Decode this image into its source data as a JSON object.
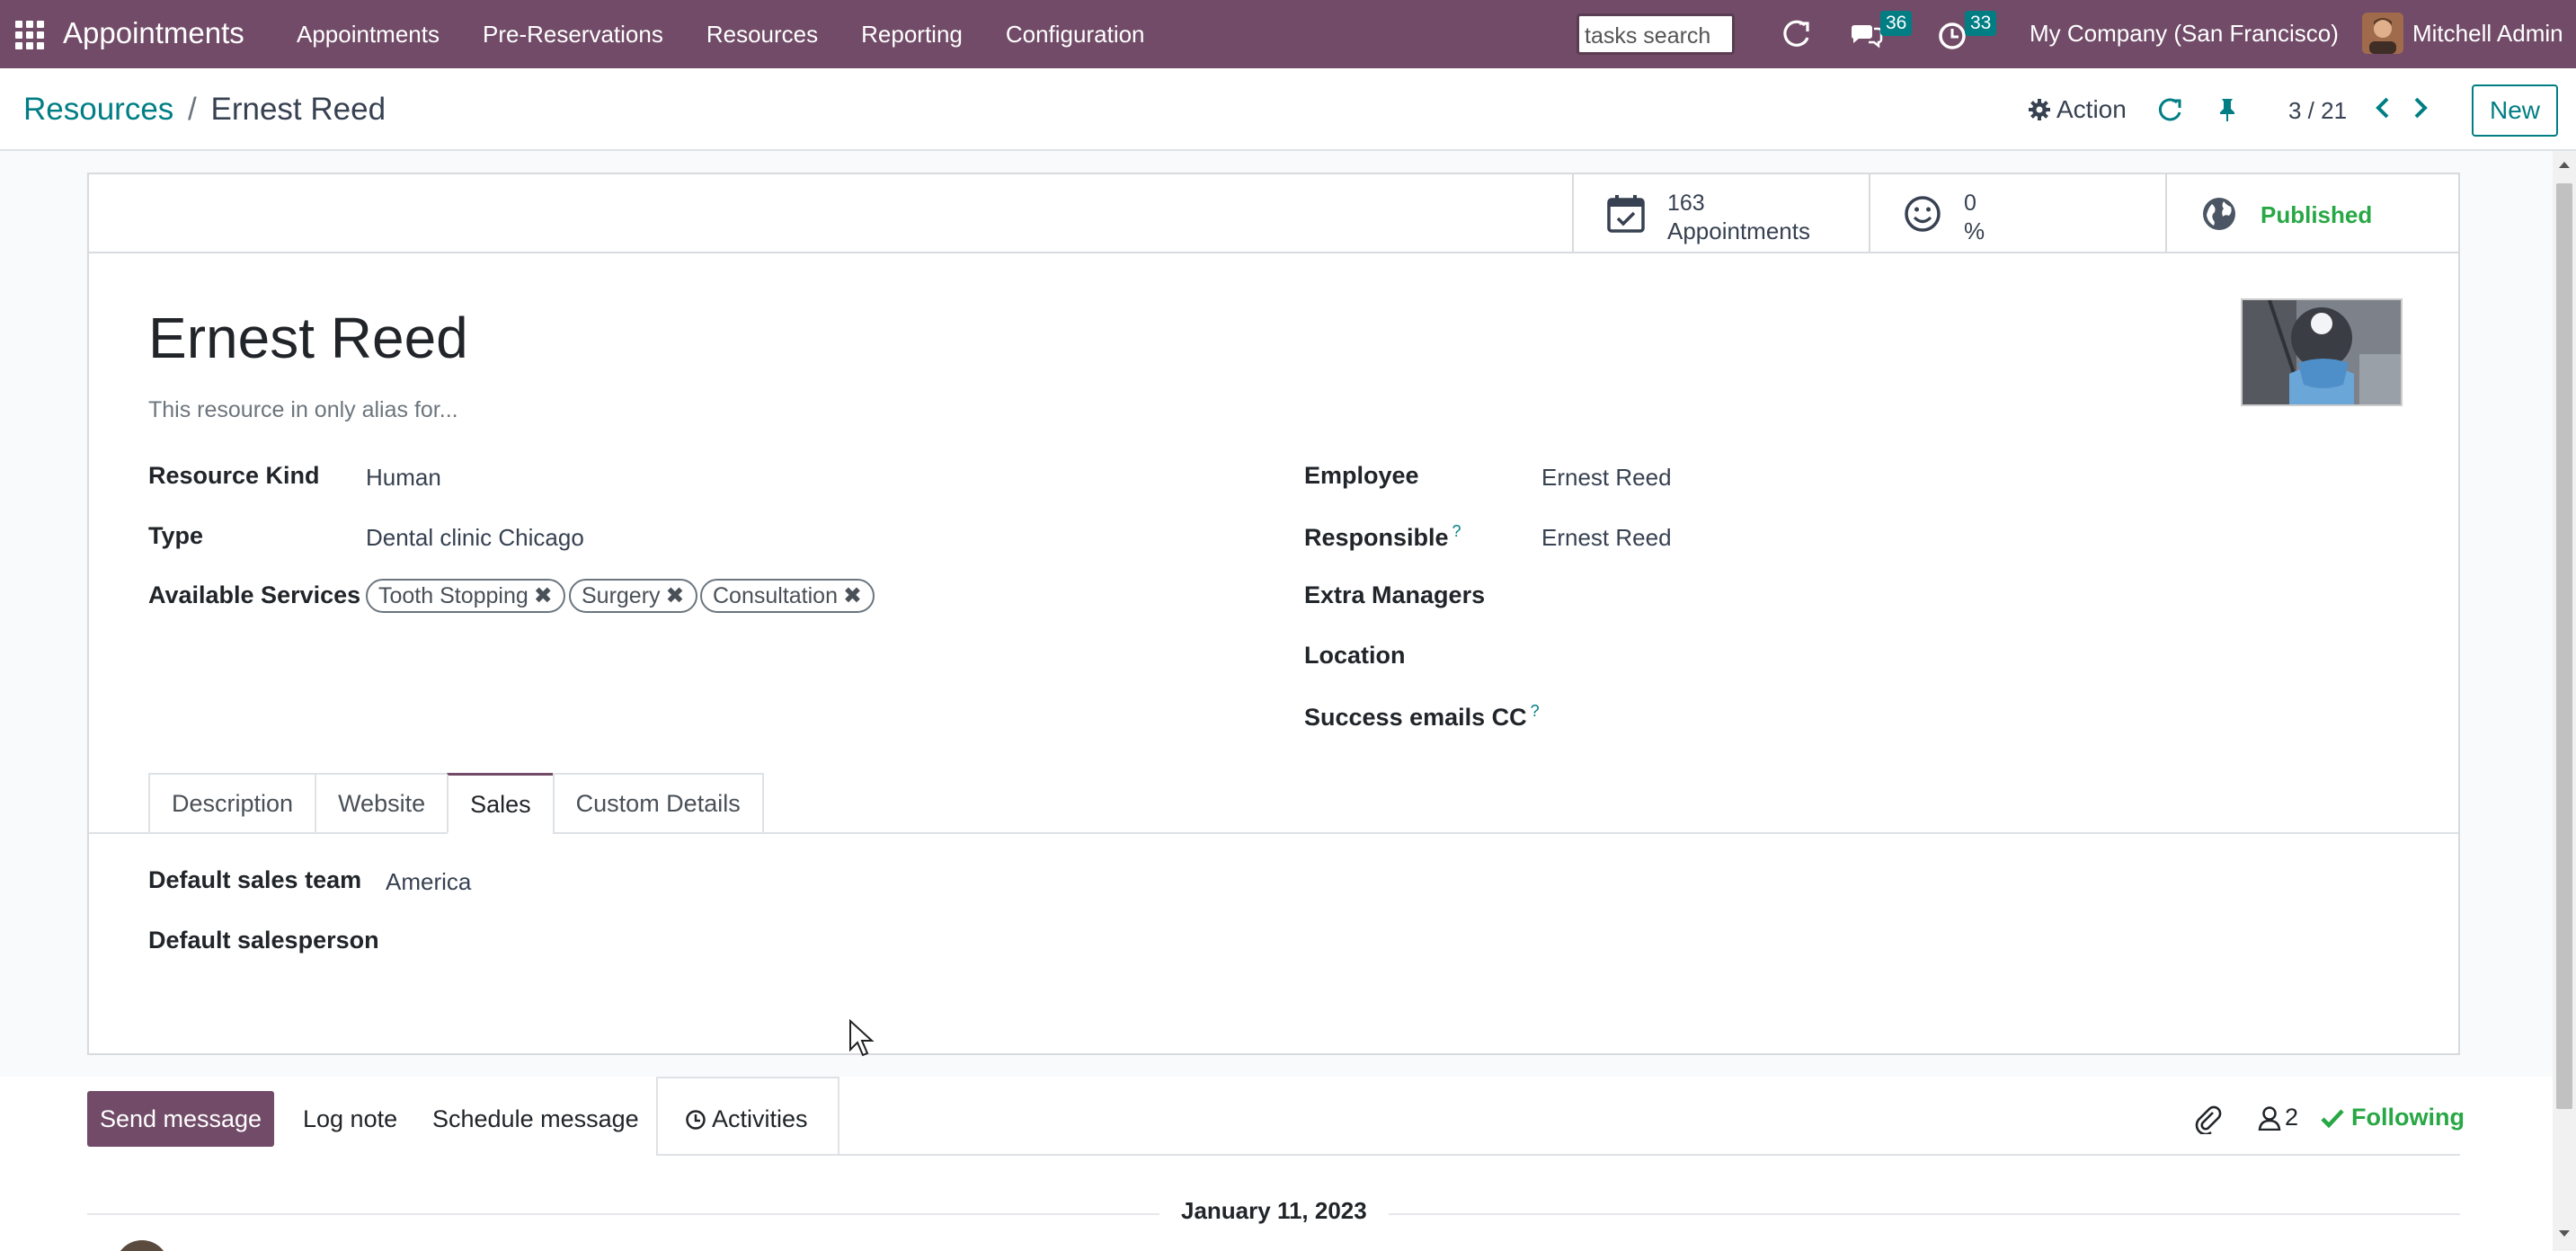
{
  "navbar": {
    "brand": "Appointments",
    "menu": [
      "Appointments",
      "Pre-Reservations",
      "Resources",
      "Reporting",
      "Configuration"
    ],
    "search_placeholder": "tasks search",
    "messages_count": "36",
    "activities_count": "33",
    "company": "My Company (San Francisco)",
    "user": "Mitchell Admin"
  },
  "control_panel": {
    "breadcrumb_parent": "Resources",
    "breadcrumb_separator": "/",
    "breadcrumb_current": "Ernest Reed",
    "action_label": "Action",
    "pager": "3 / 21",
    "new_label": "New"
  },
  "stat_buttons": {
    "appointments_value": "163",
    "appointments_label": "Appointments",
    "rating_value": "0",
    "rating_label": "%",
    "published_label": "Published"
  },
  "form": {
    "name": "Ernest Reed",
    "subtitle": "This resource in only alias for...",
    "left_fields": [
      {
        "label": "Resource Kind",
        "value": "Human"
      },
      {
        "label": "Type",
        "value": "Dental clinic Chicago"
      },
      {
        "label": "Available Services",
        "value": ""
      }
    ],
    "services": [
      "Tooth Stopping",
      "Surgery",
      "Consultation"
    ],
    "right_fields": [
      {
        "label": "Employee",
        "value": "Ernest Reed"
      },
      {
        "label": "Responsible",
        "value": "Ernest Reed",
        "help": "?"
      },
      {
        "label": "Extra Managers",
        "value": ""
      },
      {
        "label": "Location",
        "value": ""
      },
      {
        "label": "Success emails CC",
        "value": "",
        "help": "?"
      }
    ],
    "tabs": [
      "Description",
      "Website",
      "Sales",
      "Custom Details"
    ],
    "active_tab": "Sales",
    "sales_fields": [
      {
        "label": "Default sales team",
        "value": "America"
      },
      {
        "label": "Default salesperson",
        "value": ""
      }
    ]
  },
  "chatter": {
    "send_message": "Send message",
    "log_note": "Log note",
    "schedule_message": "Schedule message",
    "activities": "Activities",
    "followers_count": "2",
    "following": "Following",
    "date_separator": "January 11, 2023"
  },
  "colors": {
    "brand": "#714b67",
    "accent": "#017e84",
    "success": "#28a745"
  }
}
